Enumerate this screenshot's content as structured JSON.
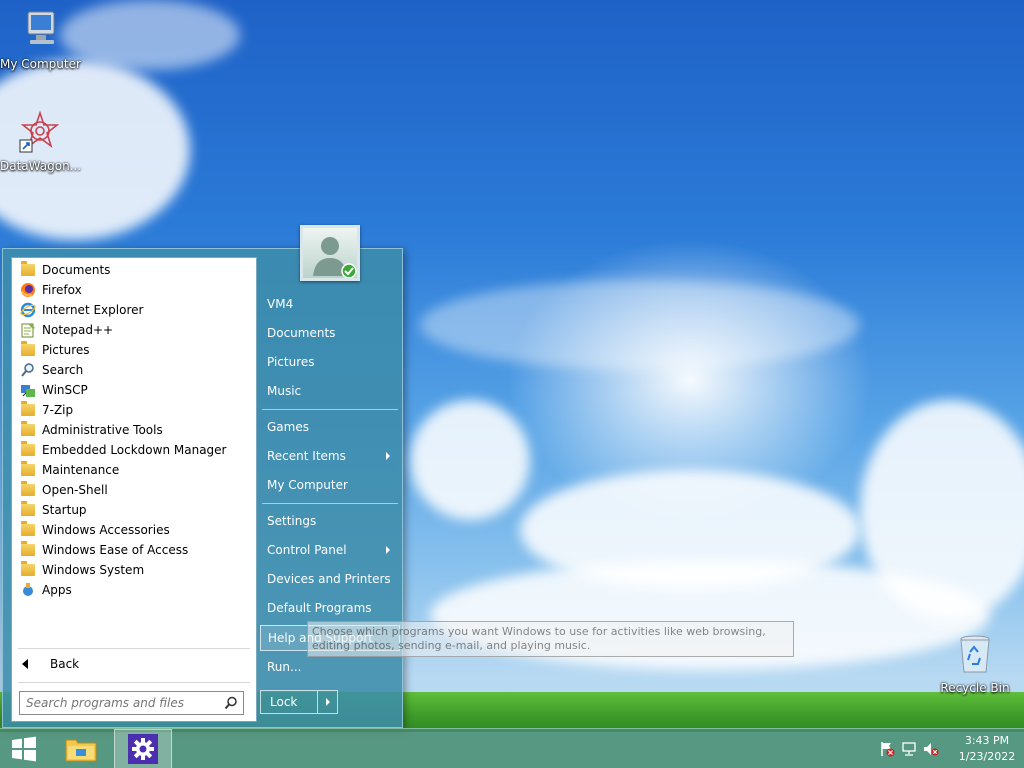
{
  "desktop": {
    "icons": [
      {
        "label": "My Computer",
        "icon": "computer-icon"
      },
      {
        "label": "DataWagon...",
        "icon": "datawagon-shortcut-icon"
      },
      {
        "label": "Recycle Bin",
        "icon": "recycle-bin-icon"
      }
    ]
  },
  "start_menu": {
    "programs": [
      {
        "label": "Documents",
        "icon": "documents-icon"
      },
      {
        "label": "Firefox",
        "icon": "firefox-icon"
      },
      {
        "label": "Internet Explorer",
        "icon": "internet-explorer-icon"
      },
      {
        "label": "Notepad++",
        "icon": "notepadpp-icon"
      },
      {
        "label": "Pictures",
        "icon": "pictures-icon"
      },
      {
        "label": "Search",
        "icon": "search-icon"
      },
      {
        "label": "WinSCP",
        "icon": "winscp-icon"
      },
      {
        "label": "7-Zip",
        "icon": "folder-icon"
      },
      {
        "label": "Administrative Tools",
        "icon": "folder-icon"
      },
      {
        "label": "Embedded Lockdown Manager",
        "icon": "folder-icon"
      },
      {
        "label": "Maintenance",
        "icon": "folder-icon"
      },
      {
        "label": "Open-Shell",
        "icon": "folder-icon"
      },
      {
        "label": "Startup",
        "icon": "folder-icon"
      },
      {
        "label": "Windows Accessories",
        "icon": "folder-icon"
      },
      {
        "label": "Windows Ease of Access",
        "icon": "folder-icon"
      },
      {
        "label": "Windows System",
        "icon": "folder-icon"
      },
      {
        "label": "Apps",
        "icon": "apps-icon"
      }
    ],
    "back_label": "Back",
    "search_placeholder": "Search programs and files",
    "right_items": {
      "user": "VM4",
      "documents": "Documents",
      "pictures": "Pictures",
      "music": "Music",
      "games": "Games",
      "recent_items": "Recent Items",
      "my_computer": "My Computer",
      "settings": "Settings",
      "control_panel": "Control Panel",
      "devices_printers": "Devices and Printers",
      "default_programs": "Default Programs",
      "help_support": "Help and Support",
      "run": "Run..."
    },
    "lock_label": "Lock",
    "tooltip": "Choose which programs you want Windows to use for activities like web browsing, editing photos, sending e-mail, and playing music."
  },
  "taskbar": {
    "start_icon": "windows-logo-icon",
    "pinned": [
      "file-explorer-icon",
      "settings-gear-icon"
    ],
    "tray_icons": [
      "action-center-flag-icon",
      "network-icon",
      "volume-muted-icon"
    ],
    "time": "3:43 PM",
    "date": "1/23/2022"
  }
}
